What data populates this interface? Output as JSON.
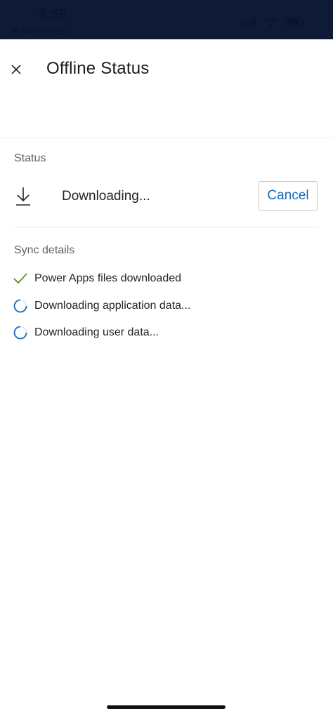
{
  "status_bar": {
    "time": "8:55",
    "back_app_label": "Authenticator"
  },
  "header": {
    "title": "Offline Status",
    "close_icon": "close-icon"
  },
  "status_section": {
    "label": "Status",
    "state_text": "Downloading...",
    "state_icon": "download-icon",
    "cancel_label": "Cancel",
    "accent_color": "#0f6cbd"
  },
  "sync_section": {
    "label": "Sync details",
    "items": [
      {
        "label": "Power Apps files downloaded",
        "icon": "checkmark-icon",
        "state": "done"
      },
      {
        "label": "Downloading application data...",
        "icon": "spinner-icon",
        "state": "in-progress"
      },
      {
        "label": "Downloading user data...",
        "icon": "spinner-icon",
        "state": "in-progress"
      }
    ]
  },
  "colors": {
    "status_bar_bg": "#0e1a36",
    "check_green": "#498205",
    "spinner_blue": "#0f6cbd"
  }
}
